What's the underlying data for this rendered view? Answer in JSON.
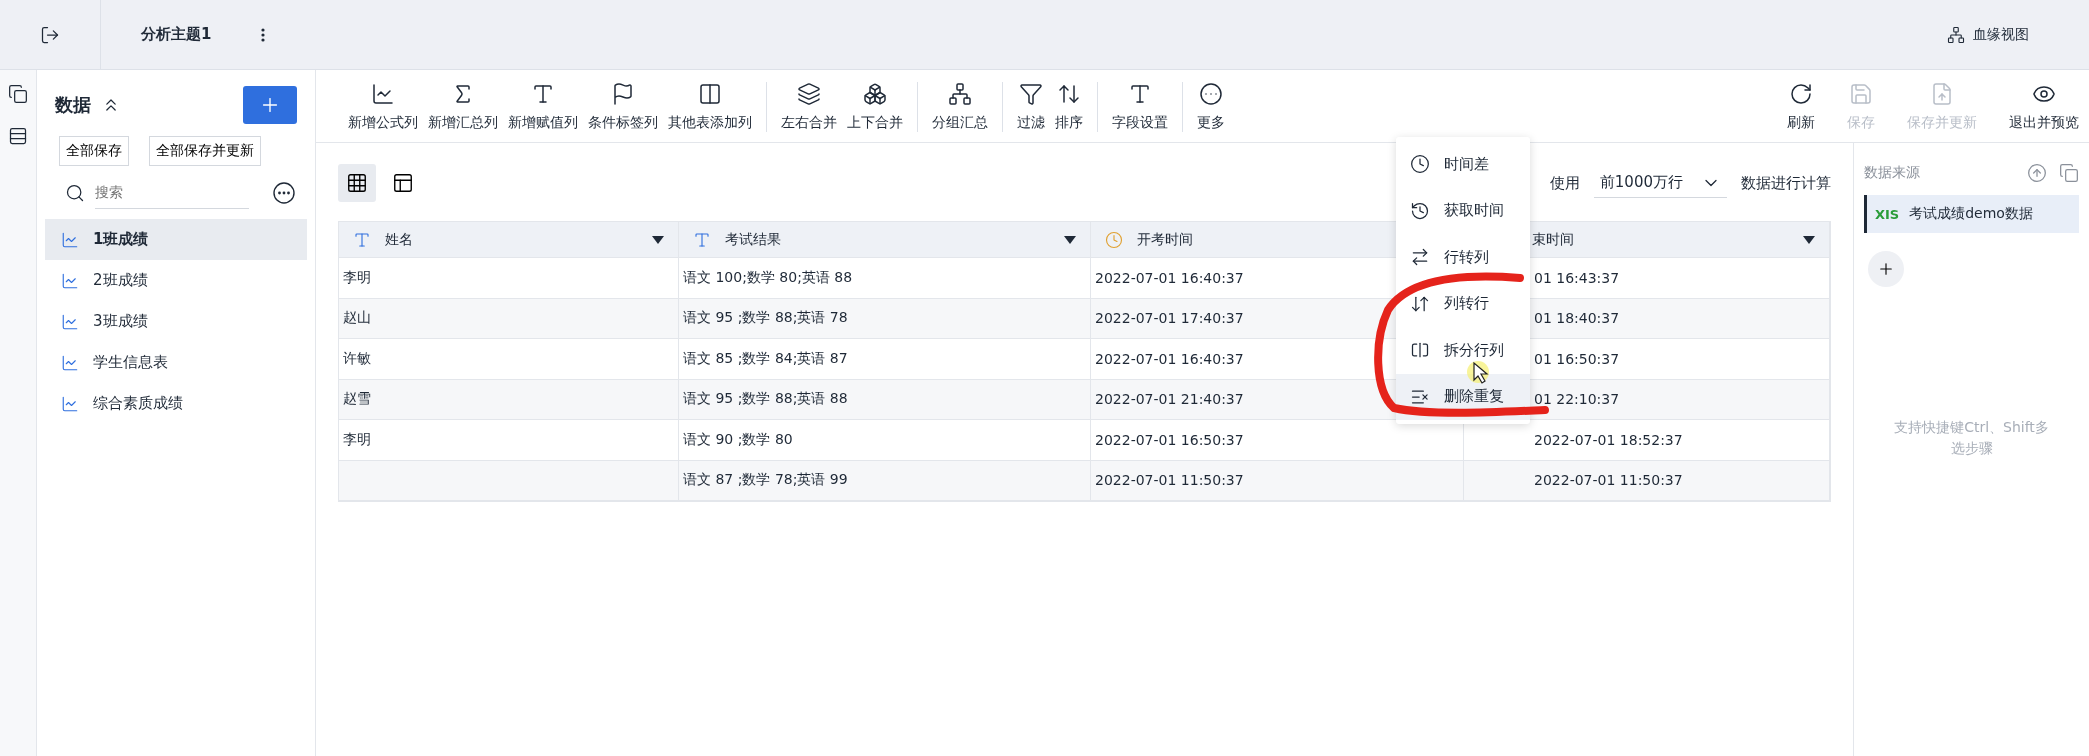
{
  "topbar": {
    "title": "分析主题1",
    "lineage": "血缘视图"
  },
  "sidebar": {
    "title": "数据",
    "buttons": [
      "全部保存",
      "全部保存并更新"
    ],
    "search": {
      "placeholder": "搜索"
    },
    "items": [
      {
        "label": "1班成绩",
        "selected": true
      },
      {
        "label": "2班成绩",
        "selected": false
      },
      {
        "label": "3班成绩",
        "selected": false
      },
      {
        "label": "学生信息表",
        "selected": false
      },
      {
        "label": "综合素质成绩",
        "selected": false
      }
    ]
  },
  "toolbar": {
    "groups": [
      [
        "新增公式列",
        "新增汇总列",
        "新增赋值列",
        "条件标签列",
        "其他表添加列"
      ],
      [
        "左右合并",
        "上下合并"
      ],
      [
        "分组汇总"
      ],
      [
        "过滤",
        "排序"
      ],
      [
        "字段设置"
      ],
      [
        "更多"
      ]
    ],
    "actions": [
      {
        "label": "刷新",
        "disabled": false
      },
      {
        "label": "保存",
        "disabled": true
      },
      {
        "label": "保存并更新",
        "disabled": true
      },
      {
        "label": "退出并预览",
        "disabled": false
      }
    ]
  },
  "views": [
    {
      "selected": true
    },
    {
      "selected": false
    }
  ],
  "rowlimit": {
    "prefix": "使用",
    "value": "前1000万行",
    "suffix": "数据进行计算"
  },
  "table": {
    "columns": [
      {
        "name": "姓名",
        "kind": "text"
      },
      {
        "name": "考试结果",
        "kind": "text"
      },
      {
        "name": "开考时间",
        "kind": "time"
      },
      {
        "name": "束时间",
        "kind": "plain"
      }
    ],
    "rows": [
      [
        "李明",
        "语文 100;数学 80;英语 88",
        "2022-07-01 16:40:37",
        "01 16:43:37"
      ],
      [
        "赵山",
        "语文 95 ;数学 88;英语 78",
        "2022-07-01 17:40:37",
        "01 18:40:37"
      ],
      [
        "许敏",
        "语文 85 ;数学 84;英语 87",
        "2022-07-01 16:40:37",
        "01 16:50:37"
      ],
      [
        "赵雪",
        "语文 95 ;数学 88;英语 88",
        "2022-07-01 21:40:37",
        "01 22:10:37"
      ],
      [
        "李明",
        "语文 90 ;数学 80",
        "2022-07-01 16:50:37",
        "2022-07-01 18:52:37"
      ],
      [
        "",
        "语文 87 ;数学 78;英语 99",
        "2022-07-01 11:50:37",
        "2022-07-01 11:50:37"
      ]
    ]
  },
  "menu": {
    "items": [
      {
        "label": "时间差",
        "hovered": false
      },
      {
        "label": "获取时间",
        "hovered": false
      },
      {
        "label": "行转列",
        "hovered": false
      },
      {
        "label": "列转行",
        "hovered": false
      },
      {
        "label": "拆分行列",
        "hovered": false
      },
      {
        "label": "删除重复",
        "hovered": true
      }
    ]
  },
  "datasource": {
    "title": "数据来源",
    "source": "考试成绩demo数据",
    "badge": "XIS",
    "hint": "支持快捷键Ctrl、Shift多选步骤"
  }
}
